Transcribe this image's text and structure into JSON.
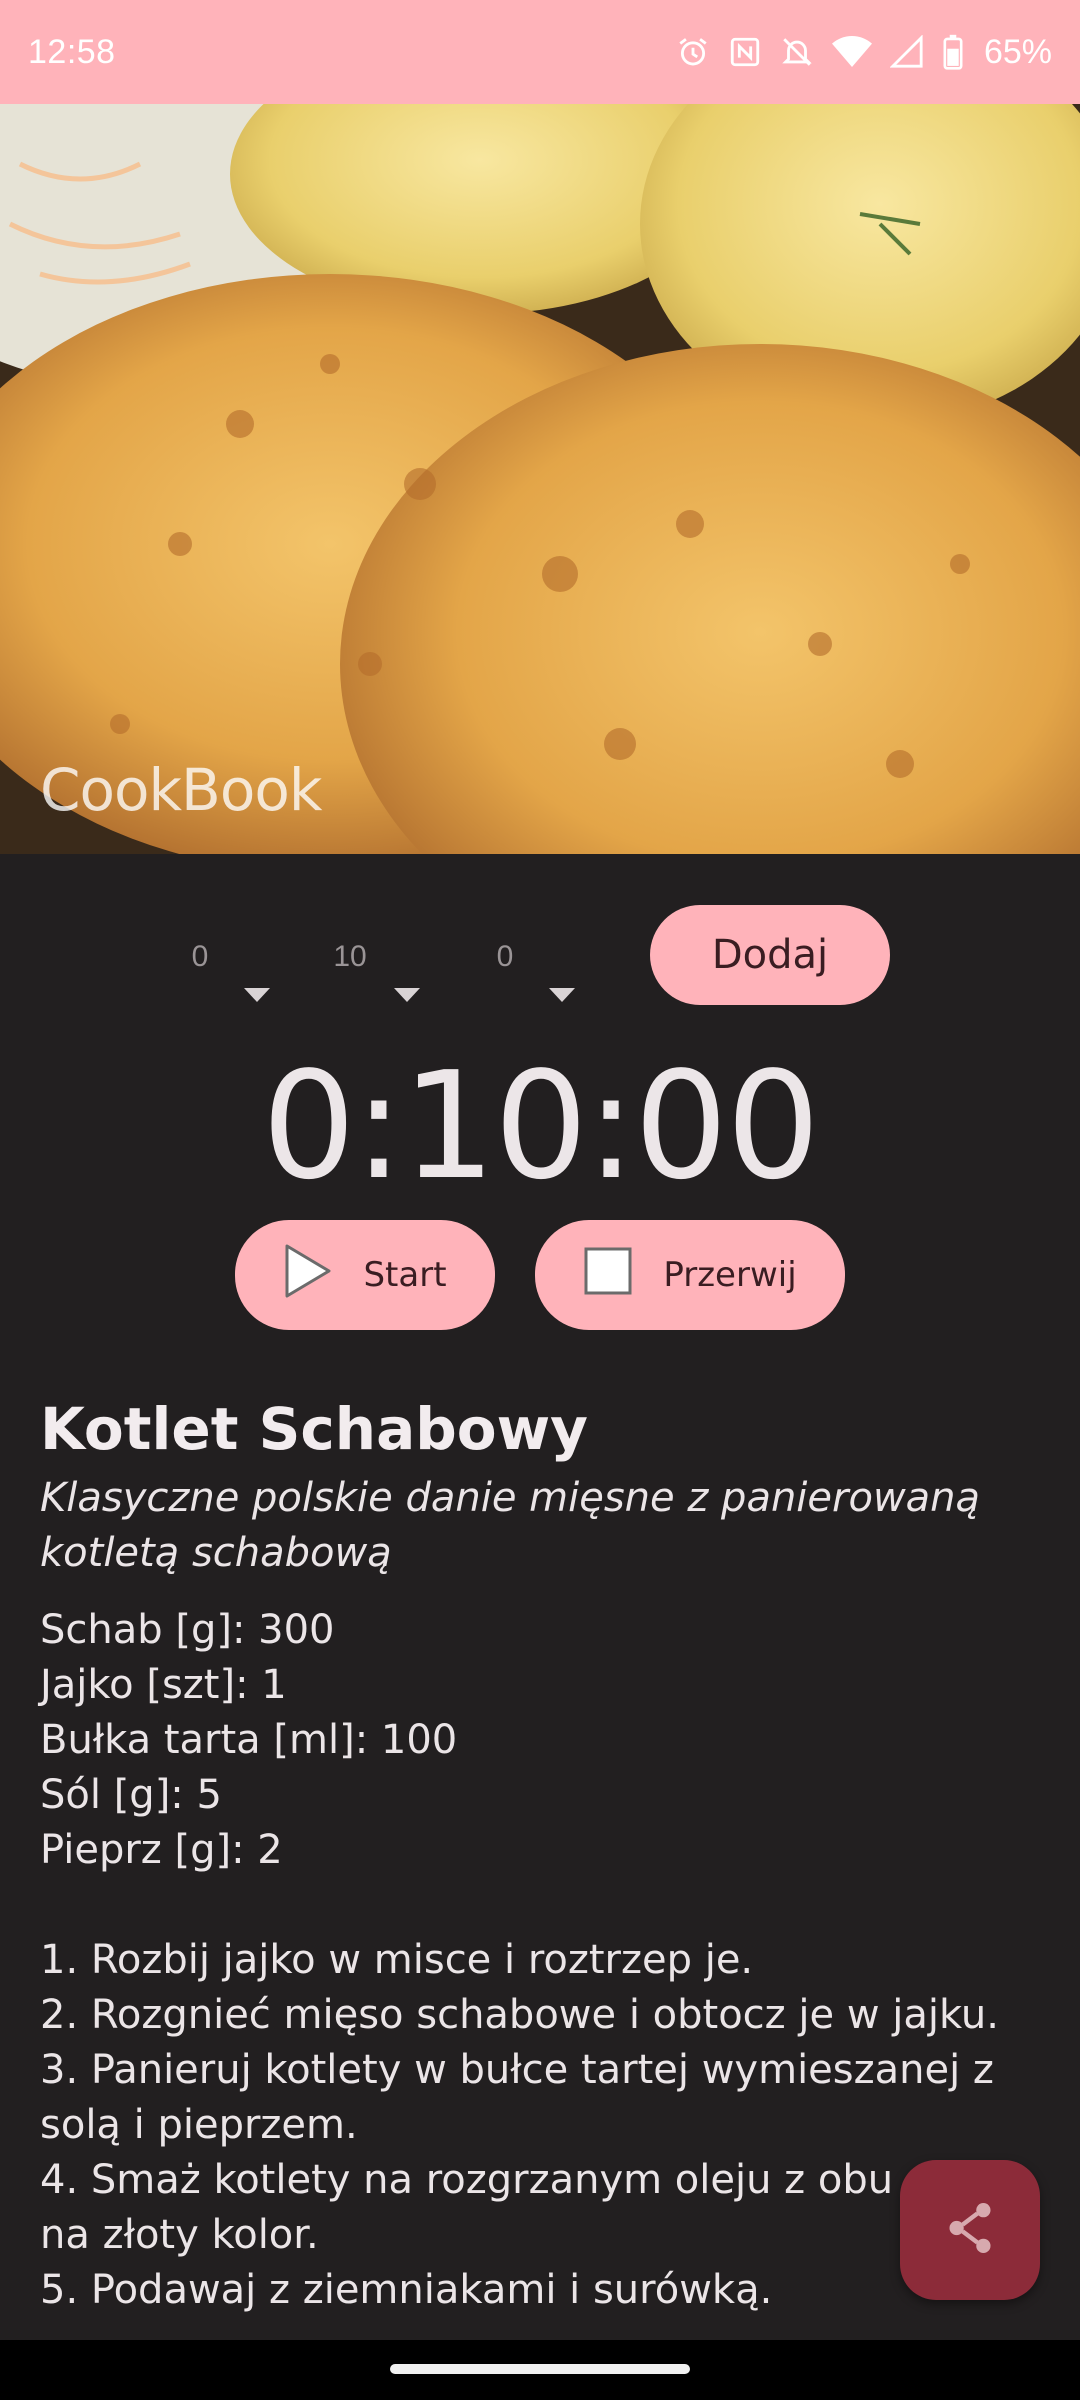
{
  "status_bar": {
    "time": "12:58",
    "battery": "65%"
  },
  "hero": {
    "app_title": "CookBook"
  },
  "timer": {
    "hours_value": "0",
    "minutes_value": "10",
    "seconds_value": "0",
    "add_label": "Dodaj",
    "display": "0:10:00",
    "start_label": "Start",
    "stop_label": "Przerwij"
  },
  "recipe": {
    "title": "Kotlet Schabowy",
    "description": "Klasyczne polskie danie mięsne z panierowaną kotletą schabową",
    "ingredients": [
      "Schab [g]: 300",
      "Jajko [szt]: 1",
      "Bułka tarta [ml]: 100",
      "Sól [g]: 5",
      "Pieprz [g]: 2"
    ],
    "steps": [
      "1. Rozbij jajko w misce i roztrzep je.",
      "2. Rozgnieć mięso schabowe i obtocz je w jajku.",
      "3. Panieruj kotlety w bułce tartej wymieszanej z solą i pieprzem.",
      "4. Smaż kotlety na rozgrzanym oleju z obu stron na złoty kolor.",
      "5. Podawaj z ziemniakami i surówką."
    ]
  },
  "colors": {
    "accent": "#ffb3ba",
    "background": "#221f20",
    "fab": "#8c2b39"
  },
  "icons": [
    "alarm-icon",
    "nfc-icon",
    "silent-icon",
    "wifi-icon",
    "signal-icon",
    "battery-icon",
    "play-icon",
    "stop-icon",
    "share-icon"
  ]
}
